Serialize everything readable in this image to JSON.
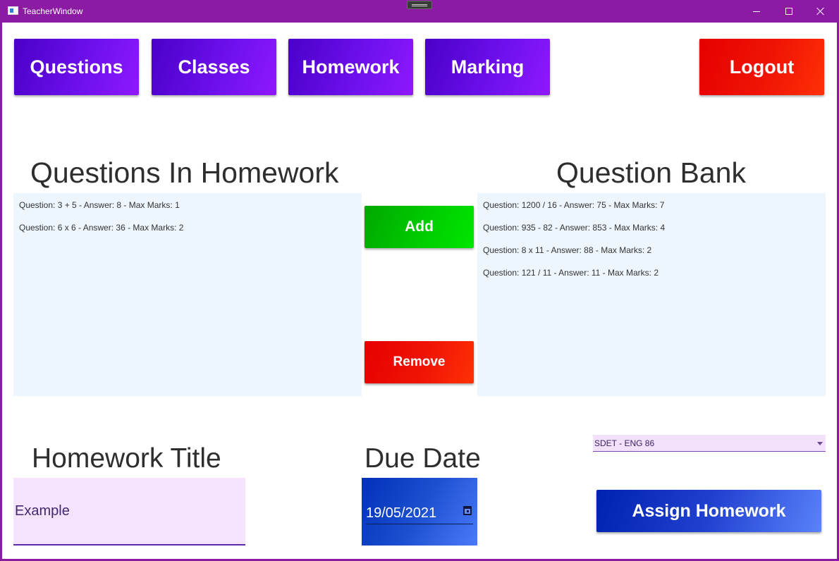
{
  "window": {
    "title": "TeacherWindow"
  },
  "nav": {
    "questions": "Questions",
    "classes": "Classes",
    "homework": "Homework",
    "marking": "Marking",
    "logout": "Logout"
  },
  "homework_panel": {
    "heading": "Questions In Homework",
    "items": [
      "Question: 3 + 5 - Answer: 8 - Max Marks: 1",
      "Question: 6 x 6 - Answer: 36 - Max Marks: 2"
    ]
  },
  "bank_panel": {
    "heading": "Question Bank",
    "items": [
      "Question: 1200 / 16 - Answer: 75 - Max Marks: 7",
      "Question: 935 - 82 - Answer: 853 - Max Marks: 4",
      "Question: 8 x 11 - Answer: 88 - Max Marks: 2",
      "Question: 121 / 11 - Answer: 11 - Max Marks: 2"
    ]
  },
  "actions": {
    "add": "Add",
    "remove": "Remove"
  },
  "form": {
    "title_heading": "Homework Title",
    "title_value": "Example",
    "due_heading": "Due Date",
    "due_value": "19/05/2021",
    "class_selected": "SDET - ENG 86",
    "assign": "Assign Homework"
  },
  "colors": {
    "title_bar": "#8a1ba2",
    "nav_purple": "#7011ef",
    "danger_red": "#f01405",
    "add_green": "#00cc00",
    "assign_blue": "#2040d0",
    "list_bg": "#eef6fd"
  }
}
